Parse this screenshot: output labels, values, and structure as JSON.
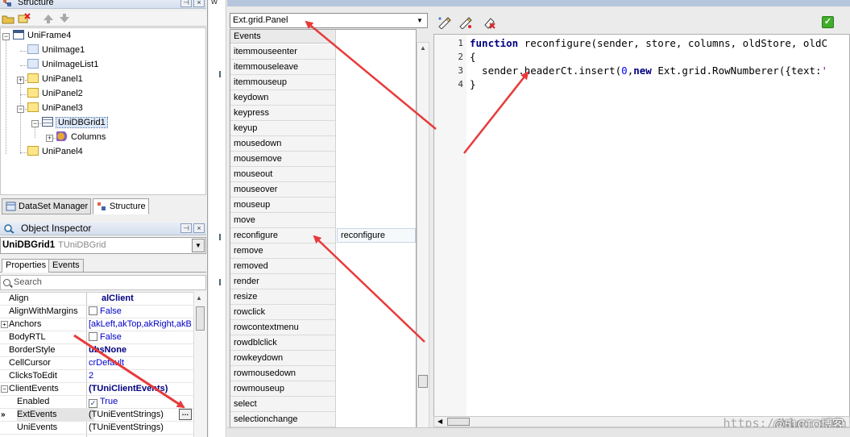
{
  "structure": {
    "title": "Structure",
    "tree": [
      {
        "label": "UniFrame4"
      },
      {
        "label": "UniImage1"
      },
      {
        "label": "UniImageList1"
      },
      {
        "label": "UniPanel1"
      },
      {
        "label": "UniPanel2"
      },
      {
        "label": "UniPanel3"
      },
      {
        "label": "UniDBGrid1"
      },
      {
        "label": "Columns"
      },
      {
        "label": "UniPanel4"
      }
    ]
  },
  "bottom_tabs": [
    {
      "label": "DataSet Manager"
    },
    {
      "label": "Structure"
    }
  ],
  "object_inspector": {
    "title": "Object Inspector",
    "component_name": "UniDBGrid1",
    "component_type": "TUniDBGrid",
    "tabs": [
      "Properties",
      "Events"
    ],
    "search_placeholder": "Search",
    "properties": [
      {
        "name": "Align",
        "value": "alClient"
      },
      {
        "name": "AlignWithMargins",
        "value": "False"
      },
      {
        "name": "Anchors",
        "value": "[akLeft,akTop,akRight,akB"
      },
      {
        "name": "BodyRTL",
        "value": "False"
      },
      {
        "name": "BorderStyle",
        "value": "ubsNone"
      },
      {
        "name": "CellCursor",
        "value": "crDefault"
      },
      {
        "name": "ClicksToEdit",
        "value": "2"
      },
      {
        "name": "ClientEvents",
        "value": "(TUniClientEvents)"
      },
      {
        "name": "Enabled",
        "value": "True"
      },
      {
        "name": "ExtEvents",
        "value": "(TUniEventStrings)"
      },
      {
        "name": "UniEvents",
        "value": "(TUniEventStrings)"
      }
    ]
  },
  "dialog": {
    "class_combo": "Ext.grid.Panel",
    "events_header": "Events",
    "events": [
      "itemmouseenter",
      "itemmouseleave",
      "itemmouseup",
      "keydown",
      "keypress",
      "keyup",
      "mousedown",
      "mousemove",
      "mouseout",
      "mouseover",
      "mouseup",
      "move",
      "reconfigure",
      "remove",
      "removed",
      "render",
      "resize",
      "rowclick",
      "rowcontextmenu",
      "rowdblclick",
      "rowkeydown",
      "rowmousedown",
      "rowmouseup",
      "select",
      "selectionchange"
    ],
    "assigned_handler": "reconfigure",
    "code": {
      "lines": [
        {
          "n": "1",
          "text": "function reconfigure(sender, store, columns, oldStore, oldC"
        },
        {
          "n": "2",
          "text": "{"
        },
        {
          "n": "3",
          "text": "  sender.headerCt.insert(0,new Ext.grid.RowNumberer({text:'"
        },
        {
          "n": "4",
          "text": "}"
        }
      ]
    },
    "watermark_url": "https://blog.csdn",
    "watermark_brand": "@51CTO博客"
  },
  "colors": {
    "arrow": "#e83a3a",
    "selection": "#dde8f8",
    "keyword": "#000080"
  }
}
